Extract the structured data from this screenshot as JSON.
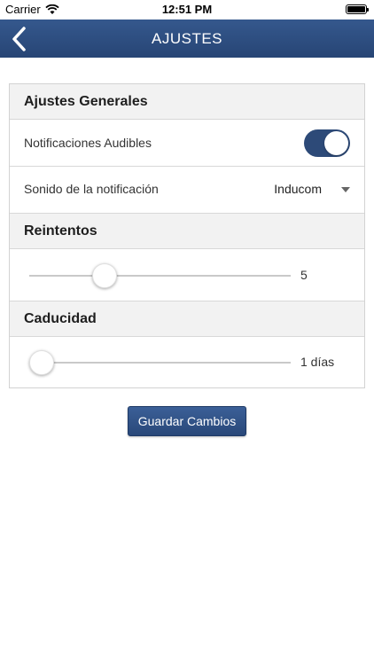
{
  "status_bar": {
    "carrier": "Carrier",
    "time": "12:51 PM"
  },
  "nav": {
    "title": "AJUSTES",
    "back_icon": "chevron-left-icon"
  },
  "general": {
    "header": "Ajustes Generales",
    "audible_label": "Notificaciones Audibles",
    "audible_on": true,
    "sound_label": "Sonido de la notificación",
    "sound_value": "Inducom"
  },
  "retries": {
    "header": "Reintentos",
    "value": "5",
    "fraction": 0.24
  },
  "expiry": {
    "header": "Caducidad",
    "value": "1 días",
    "fraction": 0.0
  },
  "save_label": "Guardar Cambios",
  "colors": {
    "nav": "#2f4f82",
    "accent": "#2d4a78"
  }
}
